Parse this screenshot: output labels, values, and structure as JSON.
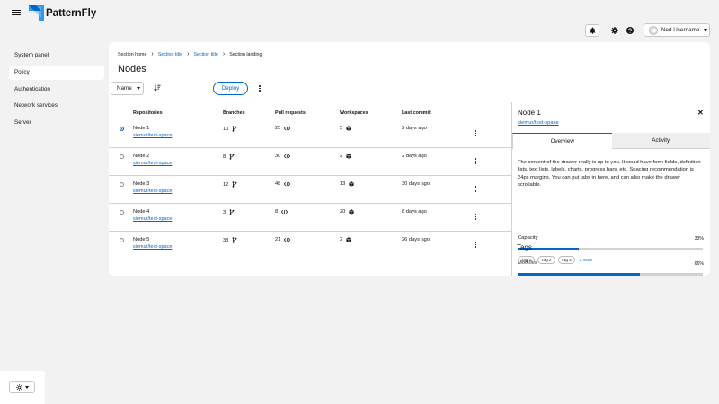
{
  "brand": {
    "name": "PatternFly"
  },
  "header": {
    "user_name": "Ned Username"
  },
  "sidebar": {
    "items": [
      {
        "label": "System panel",
        "active": false
      },
      {
        "label": "Policy",
        "active": true
      },
      {
        "label": "Authentication",
        "active": false
      },
      {
        "label": "Network services",
        "active": false
      },
      {
        "label": "Server",
        "active": false
      }
    ]
  },
  "breadcrumb": {
    "home": "Section home",
    "item1": "Section title",
    "item2": "Section title",
    "current": "Section landing"
  },
  "page": {
    "title": "Nodes"
  },
  "toolbar": {
    "sort_label": "Name",
    "deploy_label": "Deploy"
  },
  "table": {
    "columns": {
      "repositories": "Repositories",
      "branches": "Branches",
      "pull_requests": "Pull requests",
      "workspaces": "Workspaces",
      "last_commit": "Last commit"
    },
    "rows": [
      {
        "name": "Node 1",
        "link": "siemur/test-space",
        "branches": "10",
        "prs": "25",
        "workspaces": "5",
        "last_commit": "2 days ago",
        "selected": true
      },
      {
        "name": "Node 2",
        "link": "siemur/test-space",
        "branches": "8",
        "prs": "30",
        "workspaces": "2",
        "last_commit": "2 days ago",
        "selected": false
      },
      {
        "name": "Node 3",
        "link": "siemur/test-space",
        "branches": "12",
        "prs": "48",
        "workspaces": "13",
        "last_commit": "30 days ago",
        "selected": false
      },
      {
        "name": "Node 4",
        "link": "siemur/test-space",
        "branches": "3",
        "prs": "8",
        "workspaces": "20",
        "last_commit": "8 days ago",
        "selected": false
      },
      {
        "name": "Node 5",
        "link": "siemur/test-space",
        "branches": "33",
        "prs": "21",
        "workspaces": "2",
        "last_commit": "26 days ago",
        "selected": false
      }
    ]
  },
  "drawer": {
    "title": "Node 1",
    "link": "siemur/test-space",
    "tabs": [
      "Overview",
      "Activity"
    ],
    "description": "The content of the drawer really is up to you. It could have form fields, definition lists, text lists, labels, charts, progress bars, etc. Spacing recommendation is 24px margins. You can put tabs in here, and can also make the drawer scrollable.",
    "progress": [
      {
        "label": "Capacity",
        "value_text": "33%",
        "value": 33
      },
      {
        "label": "Modules",
        "value_text": "66%",
        "value": 66
      }
    ],
    "tags_heading": "Tags",
    "tags": [
      "Tag 1",
      "Tag 2",
      "Tag 3"
    ],
    "more_label": "2 more"
  },
  "colors": {
    "accent": "#0066cc",
    "background": "#f2f2f2"
  }
}
